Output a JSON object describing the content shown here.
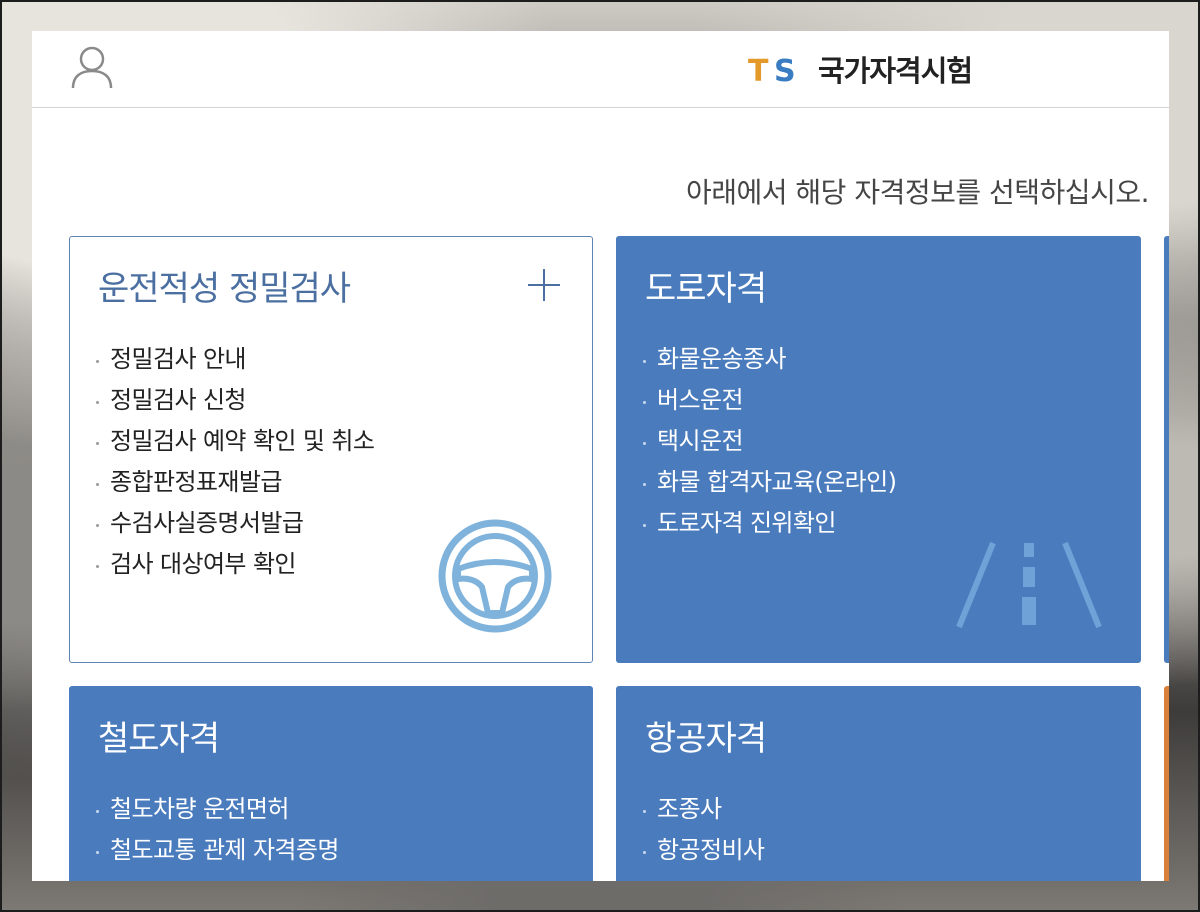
{
  "header": {
    "brand_logo_text": "TS",
    "brand_name": "국가자격시험"
  },
  "guide_text": "아래에서 해당 자격정보를 선택하십시오.",
  "colors": {
    "primary_blue": "#4a7bbd",
    "outline_title": "#4a6fa0",
    "logo_orange": "#e39a2a",
    "logo_blue": "#3a7cc2"
  },
  "cards": [
    {
      "title": "운전적성 정밀검사",
      "style": "outline",
      "icon": "steering-wheel-icon",
      "items": [
        "정밀검사 안내",
        "정밀검사 신청",
        "정밀검사 예약 확인 및 취소",
        "종합판정표재발급",
        "수검사실증명서발급",
        "검사 대상여부 확인"
      ]
    },
    {
      "title": "도로자격",
      "style": "filled",
      "icon": "road-icon",
      "items": [
        "화물운송종사",
        "버스운전",
        "택시운전",
        "화물 합격자교육(온라인)",
        "도로자격 진위확인"
      ]
    },
    {
      "title": "철도자격",
      "style": "filled",
      "items": [
        "철도차량 운전면허",
        "철도교통 관제 자격증명"
      ]
    },
    {
      "title": "항공자격",
      "style": "filled",
      "items": [
        "조종사",
        "항공정비사"
      ]
    }
  ]
}
